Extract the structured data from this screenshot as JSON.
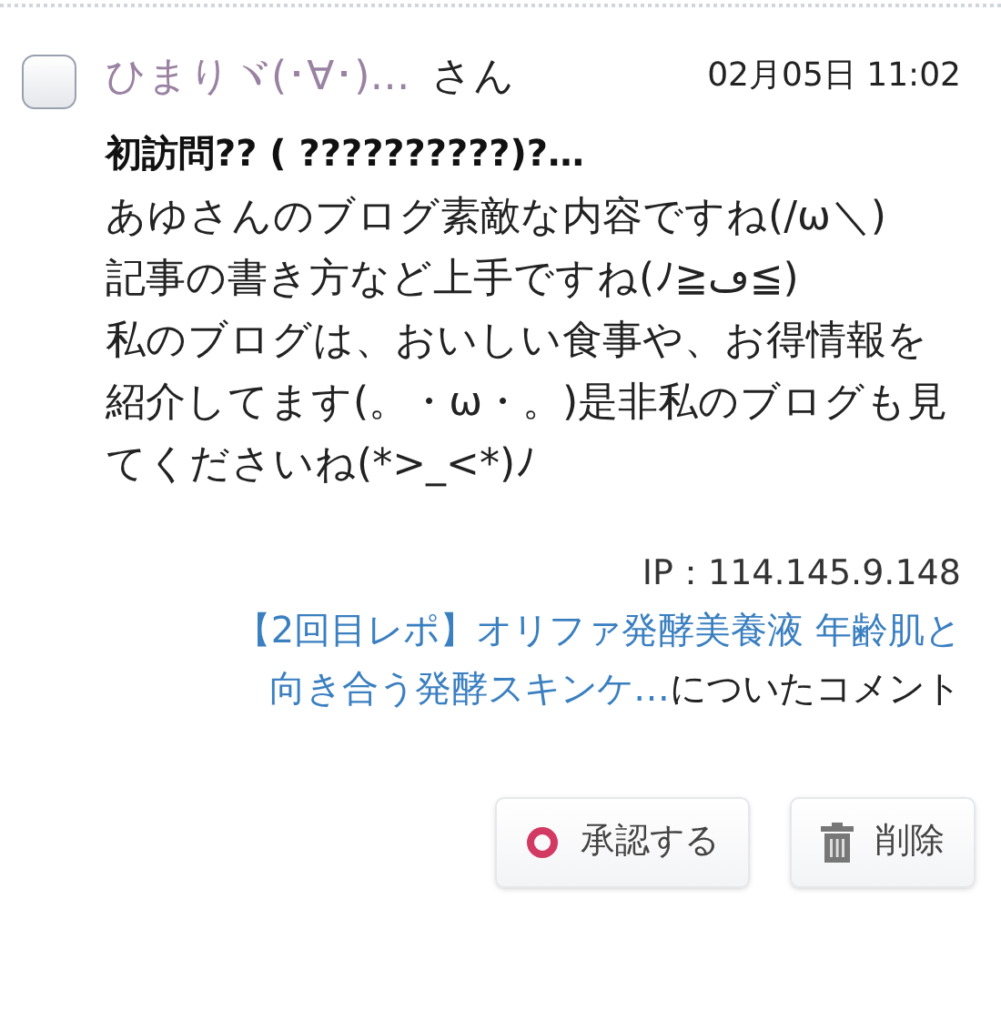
{
  "comment": {
    "checked": false,
    "author": "ひまりヾ(･∀･)…",
    "honorific": "さん",
    "date": "02月05日 11:02",
    "title": "初訪問?? ( ??????????)?…",
    "body": [
      "あゆさんのブログ素敵な内容ですね(/ω＼)",
      "記事の書き方など上手ですね(ﾉ≧ڡ≦)",
      "私のブログは、おいしい食事や、お得情報を紹介してます(。・ω・。)是非私のブログも見てくださいね(*>_<*)ﾉ"
    ],
    "ip": "IP：114.145.9.148",
    "article_link_lines": [
      "【2回目レポ】オリファ発酵美養液 年齢肌と",
      "向き合う発酵スキンケ…"
    ],
    "link_suffix": "についたコメント"
  },
  "buttons": [
    {
      "kind": "approve",
      "label": "承認する"
    },
    {
      "kind": "delete",
      "label": "削除"
    }
  ]
}
